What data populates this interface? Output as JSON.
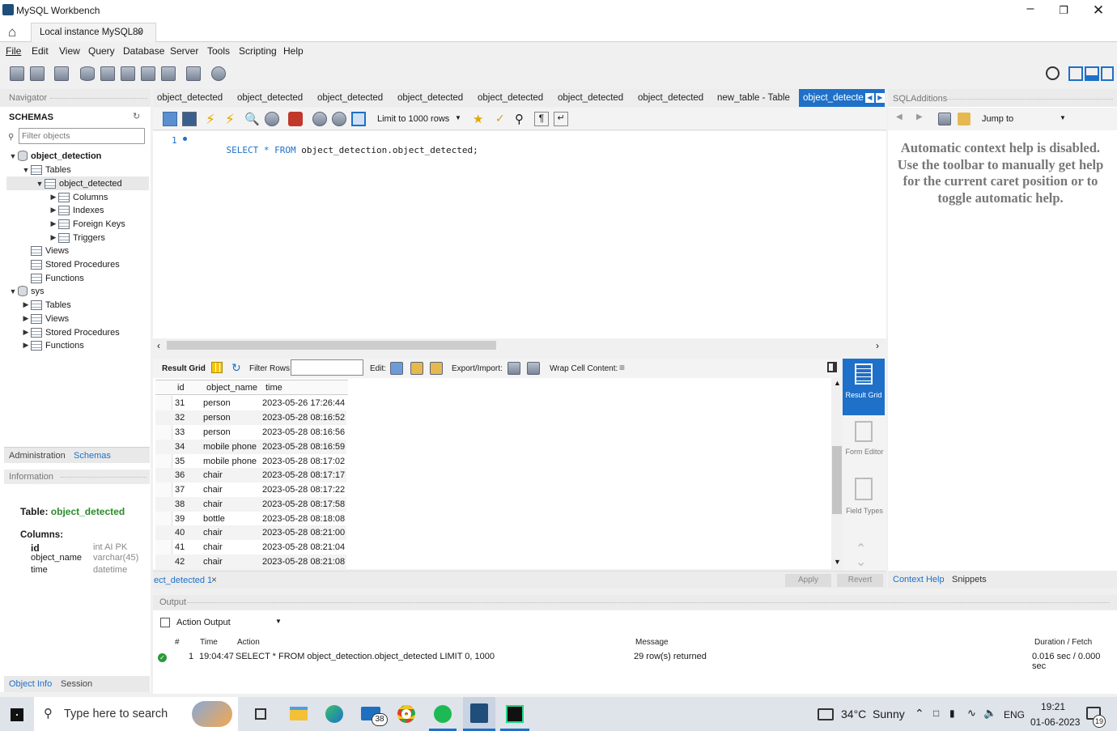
{
  "window": {
    "title": "MySQL Workbench"
  },
  "connection_tab": {
    "label": "Local instance MySQL80",
    "close": "×"
  },
  "menu": [
    "File",
    "Edit",
    "View",
    "Query",
    "Database",
    "Server",
    "Tools",
    "Scripting",
    "Help"
  ],
  "navigator": {
    "header": "Navigator",
    "schemas_label": "SCHEMAS",
    "filter_placeholder": "Filter objects",
    "tree": {
      "db1": "object_detection",
      "tables": "Tables",
      "table1": "object_detected",
      "columns": "Columns",
      "indexes": "Indexes",
      "foreign_keys": "Foreign Keys",
      "triggers": "Triggers",
      "views": "Views",
      "stored_procedures": "Stored Procedures",
      "functions": "Functions",
      "db2": "sys",
      "sys_tables": "Tables",
      "sys_views": "Views",
      "sys_stored_procedures": "Stored Procedures",
      "sys_functions": "Functions"
    },
    "tabs": {
      "administration": "Administration",
      "schemas": "Schemas"
    },
    "info_header": "Information",
    "info": {
      "table_label": "Table:",
      "table_name": "object_detected",
      "columns_label": "Columns:",
      "columns": [
        {
          "name": "id",
          "type": "int AI PK"
        },
        {
          "name": "object_name",
          "type": "varchar(45)"
        },
        {
          "name": "time",
          "type": "datetime"
        }
      ]
    },
    "bottom_tabs": {
      "object_info": "Object Info",
      "session": "Session"
    }
  },
  "editor_tabs": [
    "object_detected",
    "object_detected",
    "object_detected",
    "object_detected",
    "object_detected",
    "object_detected",
    "object_detected",
    "new_table - Table",
    "object_detecte"
  ],
  "editor": {
    "limit_label": "Limit to 1000 rows",
    "line_no": "1",
    "sql_kw1": "SELECT",
    "sql_star": "*",
    "sql_kw2": "FROM",
    "sql_rest": "object_detection.object_detected;"
  },
  "results": {
    "result_grid_label": "Result Grid",
    "filter_rows_label": "Filter Rows:",
    "edit_label": "Edit:",
    "export_label": "Export/Import:",
    "wrap_label": "Wrap Cell Content:",
    "columns": [
      "id",
      "object_name",
      "time"
    ],
    "rows": [
      [
        "31",
        "person",
        "2023-05-26 17:26:44"
      ],
      [
        "32",
        "person",
        "2023-05-28 08:16:52"
      ],
      [
        "33",
        "person",
        "2023-05-28 08:16:56"
      ],
      [
        "34",
        "mobile phone",
        "2023-05-28 08:16:59"
      ],
      [
        "35",
        "mobile phone",
        "2023-05-28 08:17:02"
      ],
      [
        "36",
        "chair",
        "2023-05-28 08:17:17"
      ],
      [
        "37",
        "chair",
        "2023-05-28 08:17:22"
      ],
      [
        "38",
        "chair",
        "2023-05-28 08:17:58"
      ],
      [
        "39",
        "bottle",
        "2023-05-28 08:18:08"
      ],
      [
        "40",
        "chair",
        "2023-05-28 08:21:00"
      ],
      [
        "41",
        "chair",
        "2023-05-28 08:21:04"
      ],
      [
        "42",
        "chair",
        "2023-05-28 08:21:08"
      ]
    ],
    "result_tab": "ect_detected 1",
    "apply": "Apply",
    "revert": "Revert",
    "side": {
      "result_grid": "Result Grid",
      "form_editor": "Form Editor",
      "field_types": "Field Types"
    }
  },
  "sql_additions": {
    "header": "SQLAdditions",
    "jump_to": "Jump to",
    "help_text": "Automatic context help is disabled. Use the toolbar to manually get help for the current caret position or to toggle automatic help.",
    "tabs": {
      "context_help": "Context Help",
      "snippets": "Snippets"
    }
  },
  "output": {
    "header": "Output",
    "dropdown": "Action Output",
    "col_hash": "#",
    "col_time": "Time",
    "col_action": "Action",
    "col_message": "Message",
    "col_duration": "Duration / Fetch",
    "row": {
      "num": "1",
      "time": "19:04:47",
      "action": "SELECT * FROM object_detection.object_detected LIMIT 0, 1000",
      "message": "29 row(s) returned",
      "duration": "0.016 sec / 0.000 sec"
    }
  },
  "taskbar": {
    "search_placeholder": "Type here to search",
    "weather": "34°C  Sunny",
    "lang": "ENG",
    "time": "19:21",
    "date": "01-06-2023",
    "mail_badge": "38",
    "notif_badge": "19"
  },
  "colors": {
    "accent": "#1e70c8",
    "green": "#2a8a2a",
    "titlebar": "#ffffff"
  }
}
